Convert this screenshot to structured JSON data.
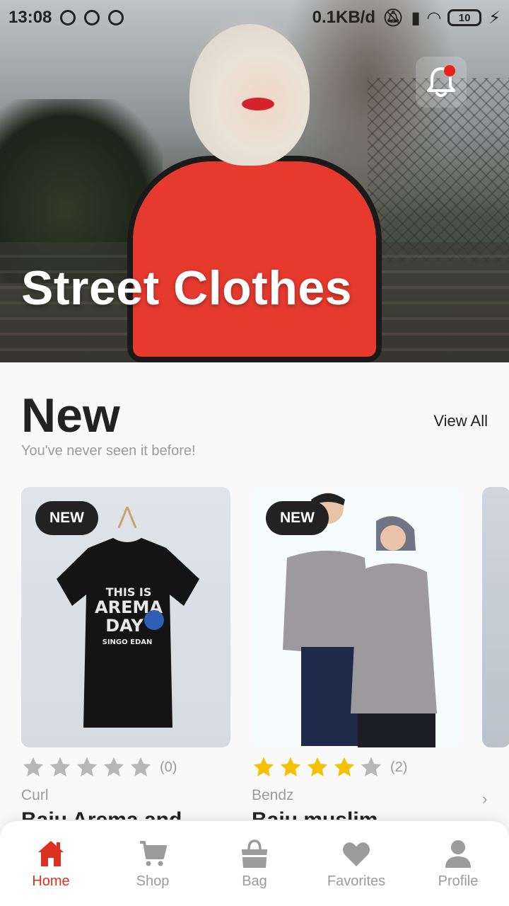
{
  "status_bar": {
    "time": "13:08",
    "net_speed": "0.1KB/d",
    "battery": "10"
  },
  "hero": {
    "title": "Street Clothes"
  },
  "section": {
    "title": "New",
    "subtitle": "You've never seen it before!",
    "view_all": "View All"
  },
  "products": [
    {
      "badge": "NEW",
      "rating": 0,
      "rating_count": "(0)",
      "brand": "Curl",
      "name": "Baju Arema and"
    },
    {
      "badge": "NEW",
      "rating": 4,
      "rating_count": "(2)",
      "brand": "Bendz",
      "name": "Baju muslim"
    }
  ],
  "partial_card": {
    "chevron": "›"
  },
  "bottom_nav": {
    "items": [
      {
        "label": "Home",
        "icon": "home-icon",
        "active": true
      },
      {
        "label": "Shop",
        "icon": "cart-icon",
        "active": false
      },
      {
        "label": "Bag",
        "icon": "bag-icon",
        "active": false
      },
      {
        "label": "Favorites",
        "icon": "heart-icon",
        "active": false
      },
      {
        "label": "Profile",
        "icon": "person-icon",
        "active": false
      }
    ]
  },
  "colors": {
    "accent": "#db3022",
    "star_filled": "#f5c000",
    "star_empty": "#9b9b9b",
    "text_dark": "#222222",
    "text_muted": "#9b9b9b"
  }
}
